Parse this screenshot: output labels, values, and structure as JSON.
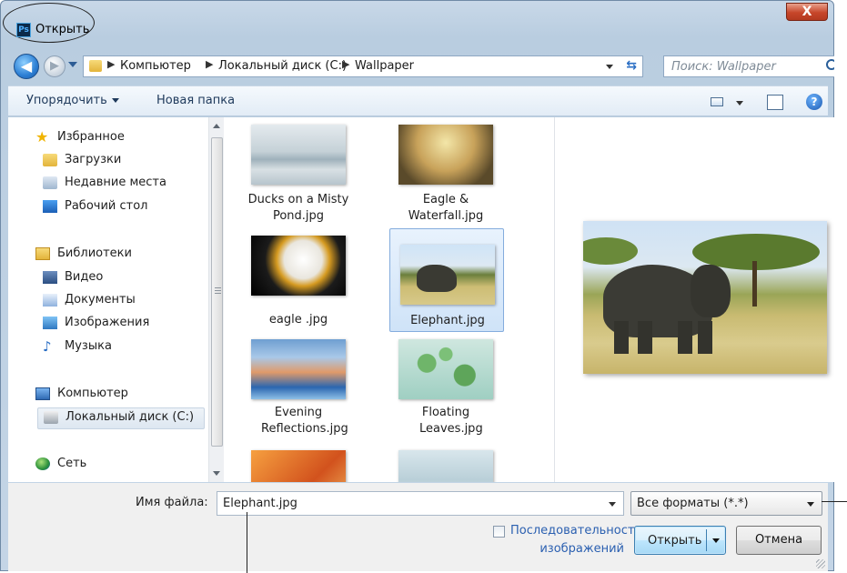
{
  "window": {
    "title": "Открыть",
    "app_icon": "Ps",
    "close_label": "X"
  },
  "nav": {
    "breadcrumb": [
      "Компьютер",
      "Локальный диск (C:)",
      "Wallpaper"
    ],
    "search_placeholder": "Поиск: Wallpaper"
  },
  "toolbar": {
    "organize_label": "Упорядочить",
    "new_folder_label": "Новая папка"
  },
  "sidebar": {
    "items": [
      {
        "label": "Избранное",
        "icon": "star-icon"
      },
      {
        "label": "Загрузки",
        "icon": "downloads-folder-icon"
      },
      {
        "label": "Недавние места",
        "icon": "recent-places-icon"
      },
      {
        "label": "Рабочий стол",
        "icon": "desktop-icon"
      },
      {
        "label": "Библиотеки",
        "icon": "libraries-icon"
      },
      {
        "label": "Видео",
        "icon": "video-icon"
      },
      {
        "label": "Документы",
        "icon": "documents-icon"
      },
      {
        "label": "Изображения",
        "icon": "pictures-icon"
      },
      {
        "label": "Музыка",
        "icon": "music-icon"
      },
      {
        "label": "Компьютер",
        "icon": "computer-icon"
      },
      {
        "label": "Локальный диск (C:)",
        "icon": "disk-icon"
      },
      {
        "label": "Сеть",
        "icon": "network-icon"
      }
    ]
  },
  "files": [
    {
      "name": "Ducks on a Misty Pond.jpg"
    },
    {
      "name": "Eagle & Waterfall.jpg"
    },
    {
      "name": "eagle .jpg"
    },
    {
      "name": "Elephant.jpg",
      "selected": true
    },
    {
      "name": "Evening Reflections.jpg"
    },
    {
      "name": "Floating Leaves.jpg"
    },
    {
      "name": ""
    },
    {
      "name": ""
    }
  ],
  "bottom": {
    "filename_label": "Имя файла:",
    "filename_value": "Elephant.jpg",
    "filetype_value": "Все форматы (*.*)",
    "sequence_label": "Последовательность изображений",
    "open_label": "Открыть",
    "cancel_label": "Отмена"
  }
}
